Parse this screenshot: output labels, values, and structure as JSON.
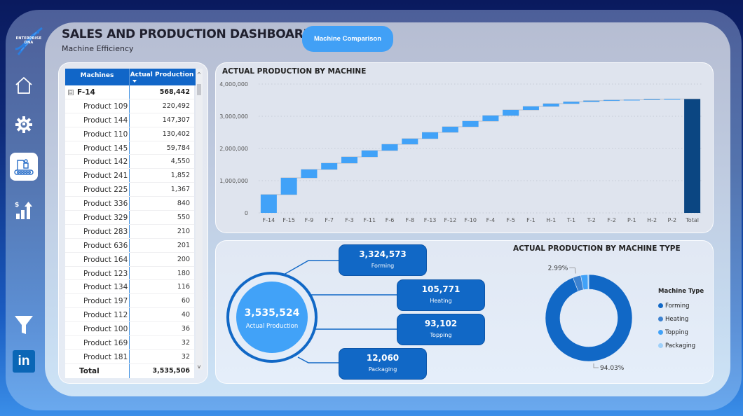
{
  "header": {
    "title": "SALES AND PRODUCTION DASHBOARD",
    "subtitle": "Machine Efficiency",
    "machine_comparison_button": "Machine Comparison",
    "logo_text": "ENTERPRISE DNA"
  },
  "sidebar": {
    "items": [
      {
        "name": "home",
        "icon": "home-icon",
        "active": false
      },
      {
        "name": "machine-settings",
        "icon": "gear-icon",
        "active": false
      },
      {
        "name": "production",
        "icon": "robot-arm-conveyor-icon",
        "active": true
      },
      {
        "name": "sales",
        "icon": "revenue-growth-icon",
        "active": false
      }
    ],
    "bottom_items": [
      {
        "name": "filter",
        "icon": "filter-icon"
      },
      {
        "name": "linkedin",
        "icon": "linkedin-icon",
        "label": "in"
      }
    ]
  },
  "table": {
    "columns": [
      "Machines",
      "Actual Production"
    ],
    "sorted_column": "Actual Production",
    "sort_direction": "descending",
    "group": {
      "label": "F-14",
      "value": "568,442",
      "expanded": true,
      "expander": "⊟"
    },
    "rows": [
      {
        "label": "Product 109",
        "value": "220,492"
      },
      {
        "label": "Product 144",
        "value": "147,307"
      },
      {
        "label": "Product 110",
        "value": "130,402"
      },
      {
        "label": "Product 145",
        "value": "59,784"
      },
      {
        "label": "Product 142",
        "value": "4,550"
      },
      {
        "label": "Product 241",
        "value": "1,852"
      },
      {
        "label": "Product 225",
        "value": "1,367"
      },
      {
        "label": "Product 336",
        "value": "840"
      },
      {
        "label": "Product 329",
        "value": "550"
      },
      {
        "label": "Product 283",
        "value": "210"
      },
      {
        "label": "Product 636",
        "value": "201"
      },
      {
        "label": "Product 164",
        "value": "200"
      },
      {
        "label": "Product 123",
        "value": "180"
      },
      {
        "label": "Product 134",
        "value": "116"
      },
      {
        "label": "Product 197",
        "value": "60"
      },
      {
        "label": "Product 112",
        "value": "40"
      },
      {
        "label": "Product 100",
        "value": "36"
      },
      {
        "label": "Product 169",
        "value": "32"
      },
      {
        "label": "Product 181",
        "value": "32"
      }
    ],
    "total": {
      "label": "Total",
      "value": "3,535,506"
    },
    "scroll_up": "^",
    "scroll_down": "v"
  },
  "kpis": {
    "center": {
      "value": "3,535,524",
      "label": "Actual Production"
    },
    "boxes": [
      {
        "value": "3,324,573",
        "label": "Forming"
      },
      {
        "value": "105,771",
        "label": "Heating"
      },
      {
        "value": "93,102",
        "label": "Topping"
      },
      {
        "value": "12,060",
        "label": "Packaging"
      }
    ]
  },
  "colors": {
    "increase": "#41a2f8",
    "total": "#0b4682",
    "forming": "#1168c6",
    "heating": "#3d82d0",
    "topping": "#41a2f8",
    "packaging": "#9fd0fa",
    "table_header": "#1166c8"
  },
  "chart_data": [
    {
      "type": "waterfall",
      "title": "ACTUAL PRODUCTION BY MACHINE",
      "xlabel": "",
      "ylabel": "",
      "ylim": [
        0,
        4000000
      ],
      "yticks": [
        0,
        1000000,
        2000000,
        3000000,
        4000000
      ],
      "ytick_labels": [
        "0",
        "1,000,000",
        "2,000,000",
        "3,000,000",
        "4,000,000"
      ],
      "grid": true,
      "categories": [
        "F-14",
        "F-15",
        "F-9",
        "F-7",
        "F-3",
        "F-11",
        "F-6",
        "F-8",
        "F-13",
        "F-12",
        "F-10",
        "F-4",
        "F-5",
        "F-1",
        "H-1",
        "T-1",
        "T-2",
        "F-2",
        "P-1",
        "H-2",
        "P-2",
        "Total"
      ],
      "values": [
        568442,
        519000,
        261000,
        195000,
        196000,
        196000,
        195000,
        174000,
        196000,
        174000,
        174000,
        174000,
        174000,
        108000,
        86000,
        58000,
        35102,
        20131,
        8000,
        19771,
        4060,
        3535524
      ],
      "total_label": "Total"
    },
    {
      "type": "pie",
      "donut": true,
      "title": "ACTUAL PRODUCTION BY MACHINE TYPE",
      "legend_title": "Machine Type",
      "legend_position": "right",
      "categories": [
        "Forming",
        "Heating",
        "Topping",
        "Packaging"
      ],
      "values": [
        3324573,
        105771,
        93102,
        12060
      ],
      "percent_labels": [
        {
          "category": "Forming",
          "text": "94.03%"
        },
        {
          "category": "Heating",
          "text": "2.99%"
        }
      ]
    }
  ]
}
